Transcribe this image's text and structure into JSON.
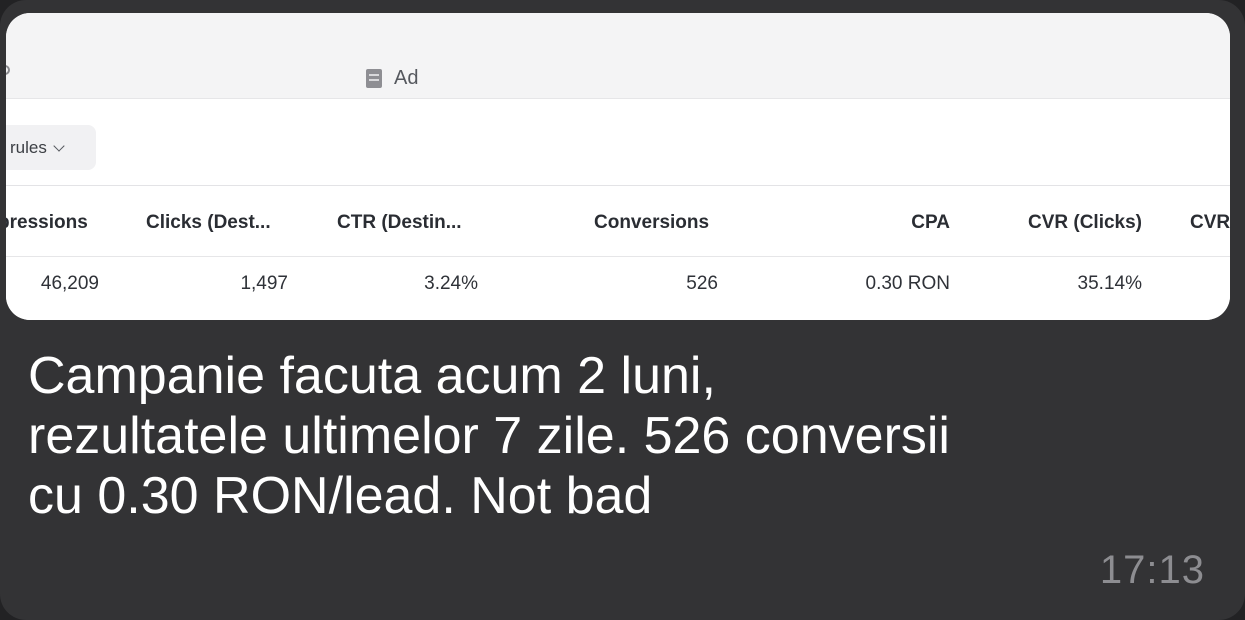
{
  "tabs": {
    "ad_label": "Ad"
  },
  "toolbar": {
    "rules_label": "rules"
  },
  "table": {
    "columns": [
      "pressions",
      "Clicks (Dest...",
      "CTR (Destin...",
      "Conversions",
      "CPA",
      "CVR (Clicks)",
      "CVR"
    ],
    "row": [
      "46,209",
      "1,497",
      "3.24%",
      "526",
      "0.30 RON",
      "35.14%"
    ]
  },
  "message": {
    "lines": [
      "Campanie facuta acum 2 luni,",
      "rezultatele ultimelor 7 zile. 526 conversii",
      "cu 0.30 RON/lead. Not bad"
    ],
    "time": "17:13"
  },
  "colors": {
    "bubble": "#333335",
    "screenshot_bg": "#ffffff",
    "message_text": "#ffffff",
    "timestamp": "#8d8d91"
  }
}
